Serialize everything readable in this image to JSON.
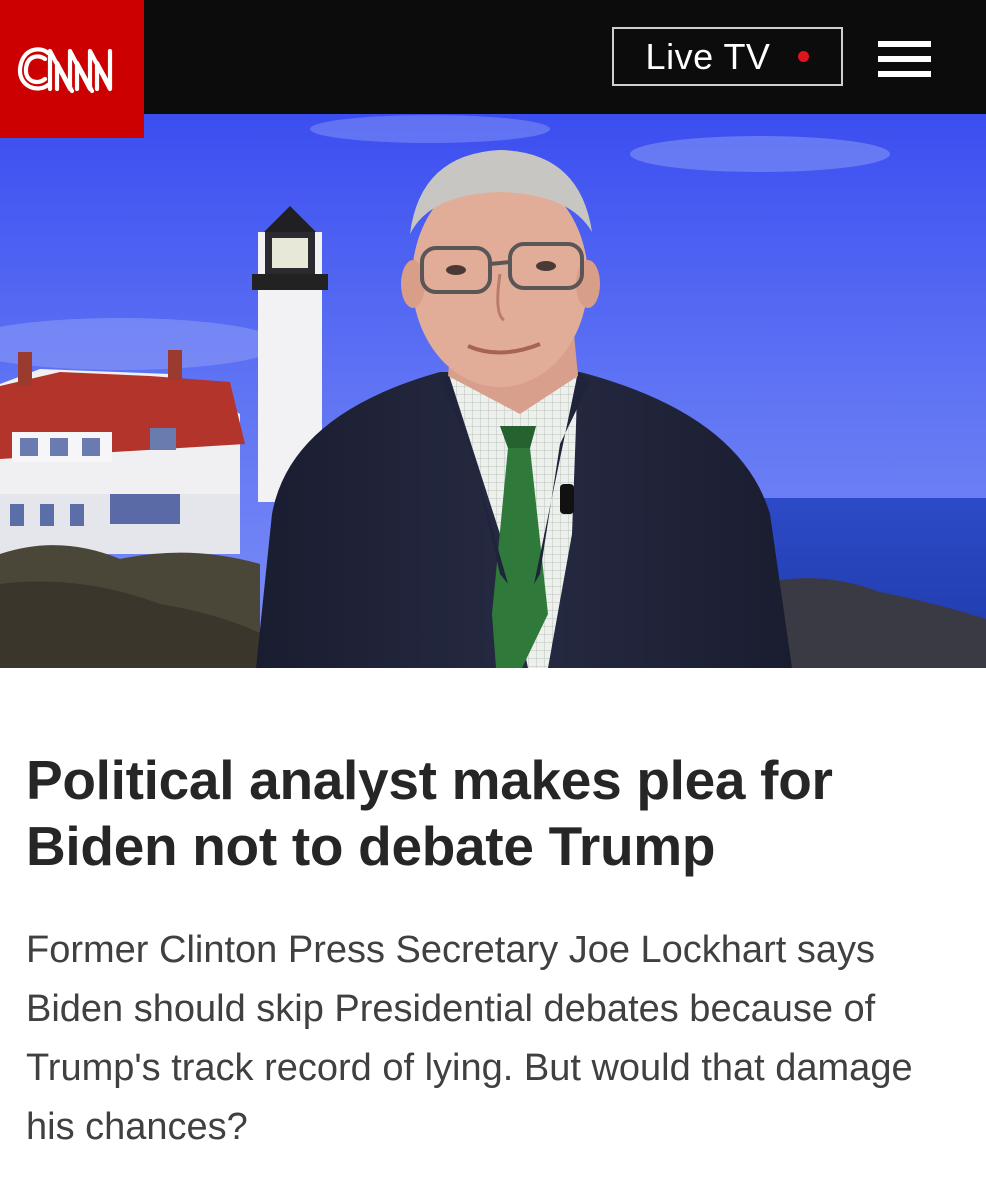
{
  "header": {
    "logo_text": "CNN",
    "live_tv_label": "Live TV",
    "menu_icon": "hamburger-menu-icon",
    "colors": {
      "brand_red": "#cc0000",
      "bar": "#0c0c0c",
      "live_dot": "#e0141e"
    }
  },
  "hero": {
    "icon": "video-still-image"
  },
  "article": {
    "headline": "Political analyst makes plea for Biden not to debate Trump",
    "description": "Former Clinton Press Secretary Joe Lockhart says Biden should skip Presidential debates because of Trump's track record of lying. But would that damage his chances?"
  }
}
